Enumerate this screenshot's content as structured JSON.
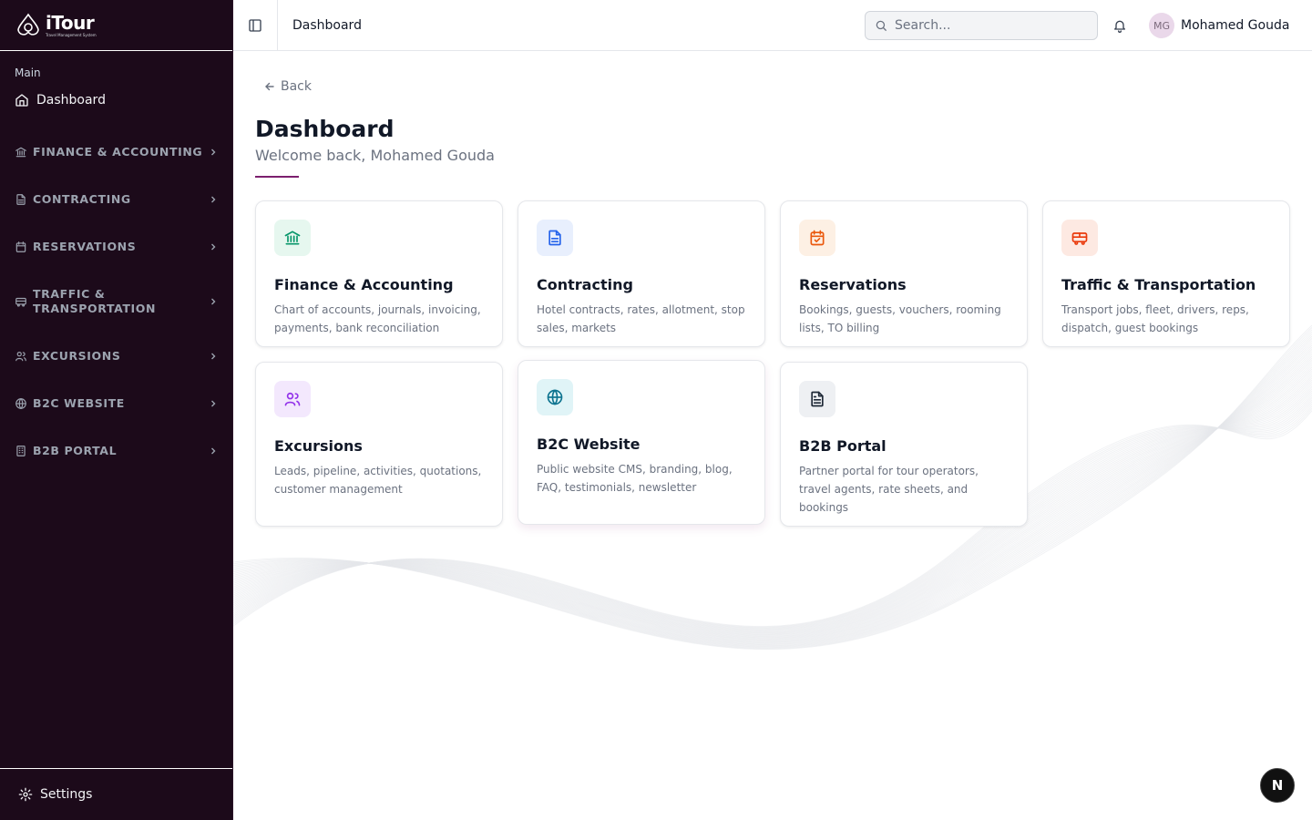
{
  "app": {
    "name": "iTour",
    "tagline": "Travel Management System"
  },
  "sidebar": {
    "section_label": "Main",
    "main_item": {
      "label": "Dashboard",
      "icon": "home-icon"
    },
    "groups": [
      {
        "label": "FINANCE & ACCOUNTING",
        "icon": "bank-icon"
      },
      {
        "label": "CONTRACTING",
        "icon": "document-icon"
      },
      {
        "label": "RESERVATIONS",
        "icon": "calendar-icon"
      },
      {
        "label": "TRAFFIC & TRANSPORTATION",
        "icon": "bus-icon"
      },
      {
        "label": "EXCURSIONS",
        "icon": "users-icon"
      },
      {
        "label": "B2C WEBSITE",
        "icon": "globe-icon"
      },
      {
        "label": "B2B PORTAL",
        "icon": "building-icon"
      }
    ],
    "settings_label": "Settings"
  },
  "topbar": {
    "breadcrumb": "Dashboard",
    "search_placeholder": "Search...",
    "user_initials": "MG",
    "user_name": "Mohamed Gouda"
  },
  "main": {
    "back_label": "Back",
    "title": "Dashboard",
    "subtitle": "Welcome back, Mohamed Gouda",
    "cards": [
      {
        "title": "Finance & Accounting",
        "desc": "Chart of accounts, journals, invoicing, payments, bank reconciliation",
        "icon": "bank-icon",
        "color": "#059669",
        "bg": "#e6f7ef"
      },
      {
        "title": "Contracting",
        "desc": "Hotel contracts, rates, allotment, stop sales, markets",
        "icon": "document-icon",
        "color": "#2563eb",
        "bg": "#e8effd"
      },
      {
        "title": "Reservations",
        "desc": "Bookings, guests, vouchers, rooming lists, TO billing",
        "icon": "calendar-check-icon",
        "color": "#ea580c",
        "bg": "#fdf0e4"
      },
      {
        "title": "Traffic & Transportation",
        "desc": "Transport jobs, fleet, drivers, reps, dispatch, guest bookings",
        "icon": "bus-icon",
        "color": "#ea3a0c",
        "bg": "#fde9e2"
      },
      {
        "title": "Excursions",
        "desc": "Leads, pipeline, activities, quotations, customer management",
        "icon": "users-icon",
        "color": "#9333ea",
        "bg": "#f3e8fd"
      },
      {
        "title": "B2C Website",
        "desc": "Public website CMS, branding, blog, FAQ, testimonials, newsletter",
        "icon": "globe-icon",
        "color": "#0e7490",
        "bg": "#e0f4f7"
      },
      {
        "title": "B2B Portal",
        "desc": "Partner portal for tour operators, travel agents, rate sheets, and bookings",
        "icon": "file-text-icon",
        "color": "#1f2937",
        "bg": "#eef0f3"
      }
    ]
  },
  "badge": {
    "label": "N"
  }
}
